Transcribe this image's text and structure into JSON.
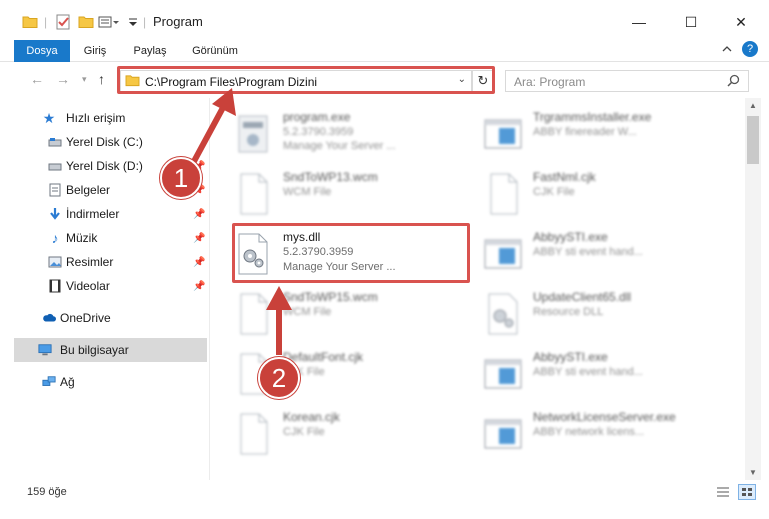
{
  "window": {
    "title": "Program",
    "minimize_glyph": "—",
    "maximize_glyph": "☐",
    "close_glyph": "✕"
  },
  "ribbon": {
    "tabs": [
      "Dosya",
      "Giriş",
      "Paylaş",
      "Görünüm"
    ],
    "active_tab": "Dosya",
    "help_glyph": "?"
  },
  "address": {
    "path": "C:\\Program Files\\Program Dizini",
    "search_placeholder": "Ara: Program"
  },
  "sidebar": {
    "items": [
      {
        "label": "Hızlı erişim",
        "icon": "star-icon"
      },
      {
        "label": "Yerel Disk (C:)",
        "icon": "drive-icon"
      },
      {
        "label": "Yerel Disk (D:)",
        "icon": "drive-icon"
      },
      {
        "label": "Belgeler",
        "icon": "documents-icon"
      },
      {
        "label": "İndirmeler",
        "icon": "download-icon"
      },
      {
        "label": "Müzik",
        "icon": "music-icon"
      },
      {
        "label": "Resimler",
        "icon": "pictures-icon"
      },
      {
        "label": "Videolar",
        "icon": "video-icon"
      },
      {
        "label": "OneDrive",
        "icon": "cloud-icon"
      },
      {
        "label": "Bu bilgisayar",
        "icon": "computer-icon"
      },
      {
        "label": "Ağ",
        "icon": "network-icon"
      }
    ],
    "selected": "Bu bilgisayar"
  },
  "files": [
    {
      "name": "program.exe",
      "line1": "5.2.3790.3959",
      "line2": "Manage Your Server ...",
      "icon": "exe-icon",
      "blurred": true
    },
    {
      "name": "TrgrammsInstaller.exe",
      "line1": "ABBY finereader W...",
      "line2": "",
      "icon": "app-window-icon",
      "blurred": true
    },
    {
      "name": "SndToWP13.wcm",
      "line1": "WCM File",
      "line2": "",
      "icon": "file-icon",
      "blurred": true
    },
    {
      "name": "FastNml.cjk",
      "line1": "CJK File",
      "line2": "",
      "icon": "file-icon",
      "blurred": true
    },
    {
      "name": "mys.dll",
      "line1": "5.2.3790.3959",
      "line2": "Manage Your Server ...",
      "icon": "dll-gear-icon",
      "blurred": false
    },
    {
      "name": "AbbyySTI.exe",
      "line1": "ABBY sti event hand...",
      "line2": "",
      "icon": "app-window-icon",
      "blurred": true
    },
    {
      "name": "SndToWP15.wcm",
      "line1": "WCM File",
      "line2": "",
      "icon": "file-icon",
      "blurred": true
    },
    {
      "name": "UpdateClient65.dll",
      "line1": "Resource DLL",
      "line2": "",
      "icon": "dll-gear-icon",
      "blurred": true
    },
    {
      "name": "DefaultFont.cjk",
      "line1": "CJK File",
      "line2": "",
      "icon": "file-icon",
      "blurred": true
    },
    {
      "name": "AbbyySTI.exe",
      "line1": "ABBY sti event hand...",
      "line2": "",
      "icon": "app-window-icon",
      "blurred": true
    },
    {
      "name": "Korean.cjk",
      "line1": "CJK File",
      "line2": "",
      "icon": "file-icon",
      "blurred": true
    },
    {
      "name": "NetworkLicenseServer.exe",
      "line1": "ABBY network licens...",
      "line2": "",
      "icon": "app-window-icon",
      "blurred": true
    }
  ],
  "status": {
    "item_count": "159 öğe"
  },
  "annotations": {
    "step1": "1",
    "step2": "2",
    "highlight_color": "#d9534f",
    "badge_color": "#c9413a"
  },
  "colors": {
    "accent": "#1979ca",
    "selected_bg": "#d9d9d9"
  }
}
